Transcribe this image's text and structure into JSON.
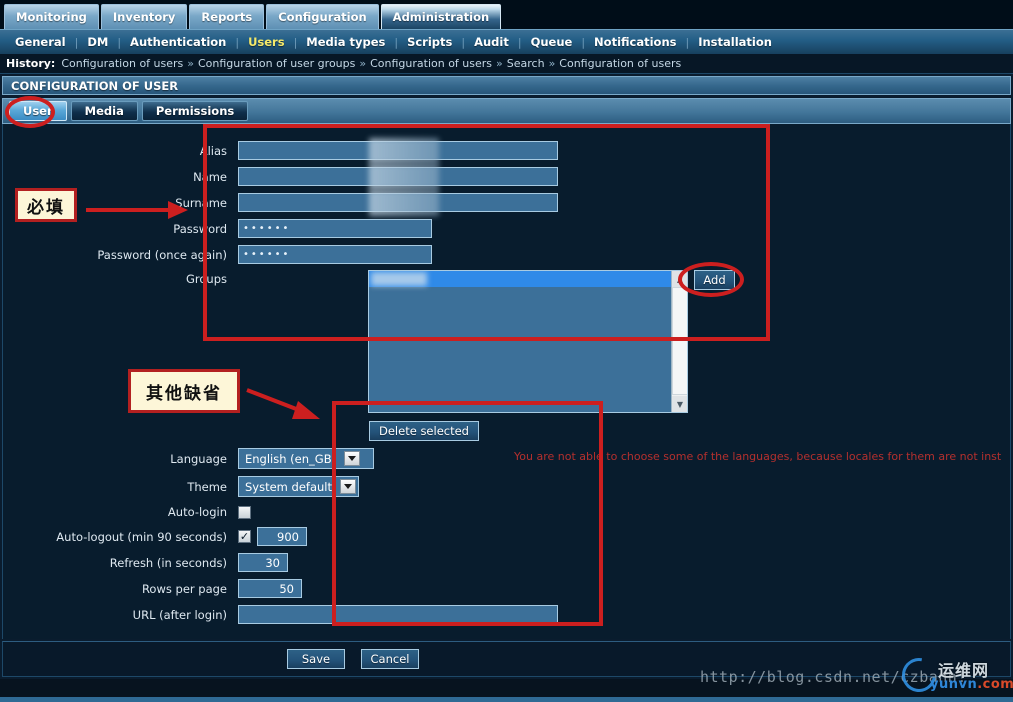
{
  "top_menu": {
    "items": [
      {
        "label": "Monitoring",
        "active": false
      },
      {
        "label": "Inventory",
        "active": false
      },
      {
        "label": "Reports",
        "active": false
      },
      {
        "label": "Configuration",
        "active": false
      },
      {
        "label": "Administration",
        "active": true
      }
    ]
  },
  "sub_menu": {
    "items": [
      {
        "label": "General",
        "active": false
      },
      {
        "label": "DM",
        "active": false
      },
      {
        "label": "Authentication",
        "active": false
      },
      {
        "label": "Users",
        "active": true
      },
      {
        "label": "Media types",
        "active": false
      },
      {
        "label": "Scripts",
        "active": false
      },
      {
        "label": "Audit",
        "active": false
      },
      {
        "label": "Queue",
        "active": false
      },
      {
        "label": "Notifications",
        "active": false
      },
      {
        "label": "Installation",
        "active": false
      }
    ]
  },
  "history": {
    "label": "History:",
    "items": [
      "Configuration of users",
      "Configuration of user groups",
      "Configuration of users",
      "Search",
      "Configuration of users"
    ],
    "separator": "»"
  },
  "page_title": "CONFIGURATION OF USER",
  "tabs": [
    {
      "label": "User",
      "active": true
    },
    {
      "label": "Media",
      "active": false
    },
    {
      "label": "Permissions",
      "active": false
    }
  ],
  "form": {
    "alias": {
      "label": "Alias",
      "value": "",
      "redacted": true
    },
    "name": {
      "label": "Name",
      "value": "",
      "redacted": true
    },
    "surname": {
      "label": "Surname",
      "value": "",
      "redacted": true
    },
    "password": {
      "label": "Password",
      "value": "••••••"
    },
    "password_again": {
      "label": "Password (once again)",
      "value": "••••••"
    },
    "groups": {
      "label": "Groups",
      "options": [
        {
          "label": "",
          "selected": true,
          "redacted": true
        }
      ],
      "add_button": "Add",
      "delete_button": "Delete selected"
    },
    "language": {
      "label": "Language",
      "value": "English (en_GB)"
    },
    "language_warning": "You are not able to choose some of the languages, because locales for them are not inst",
    "theme": {
      "label": "Theme",
      "value": "System default"
    },
    "auto_login": {
      "label": "Auto-login",
      "checked": false
    },
    "auto_logout": {
      "label": "Auto-logout (min 90 seconds)",
      "checked": true,
      "check_glyph": "✓",
      "value": "900"
    },
    "refresh": {
      "label": "Refresh (in seconds)",
      "value": "30"
    },
    "rows_per_page": {
      "label": "Rows per page",
      "value": "50"
    },
    "url_after_login": {
      "label": "URL (after login)",
      "value": ""
    }
  },
  "footer": {
    "save_label": "Save",
    "cancel_label": "Cancel"
  },
  "watermark": {
    "url": "http://blog.csdn.net/czbanh!",
    "logo_cn": "运维网",
    "logo_en_main": "yunvn",
    "logo_en_dot": ".",
    "logo_en_tld": "com"
  },
  "annotations": {
    "note_required": "必填",
    "note_defaults": "其他缺省",
    "accent_red": "#cc1f1f",
    "note_bg": "#fdf6d8"
  }
}
